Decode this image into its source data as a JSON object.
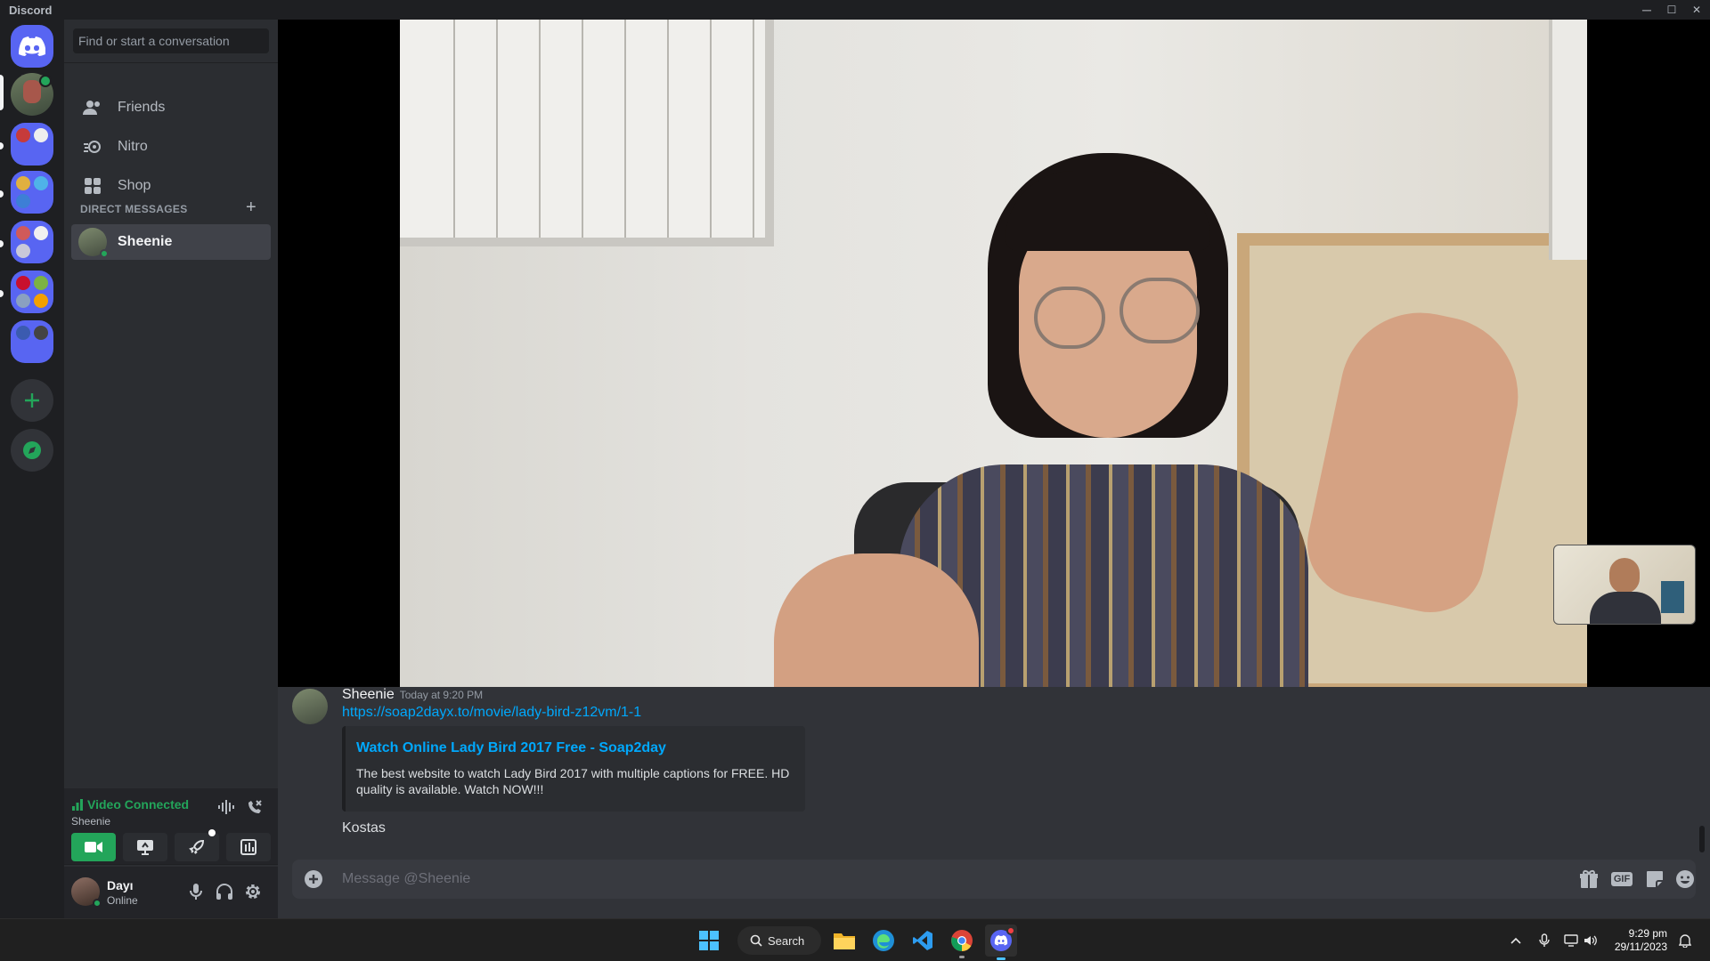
{
  "window": {
    "title": "Discord",
    "minimize": "─",
    "maximize": "☐",
    "close": "✕"
  },
  "search": {
    "placeholder": "Find or start a conversation"
  },
  "nav": {
    "friends": "Friends",
    "nitro": "Nitro",
    "shop": "Shop"
  },
  "direct_messages": {
    "header": "DIRECT MESSAGES",
    "add": "+",
    "items": [
      {
        "name": "Sheenie"
      }
    ]
  },
  "voice": {
    "status": "Video Connected",
    "channel": "Sheenie"
  },
  "user": {
    "name": "Dayı",
    "status": "Online"
  },
  "chat": {
    "author": "Sheenie",
    "timestamp": "Today at 9:20 PM",
    "link": "https://soap2dayx.to/movie/lady-bird-z12vm/1-1",
    "embed_title": "Watch Online Lady Bird 2017 Free - Soap2day",
    "embed_desc": "The best website to watch Lady Bird 2017 with multiple captions for FREE. HD quality is available. Watch NOW!!!",
    "message2": "Kostas"
  },
  "composer": {
    "placeholder": "Message @Sheenie",
    "gif": "GIF"
  },
  "taskbar": {
    "search": "Search",
    "time": "9:29 pm",
    "date": "29/11/2023"
  },
  "colors": {
    "blurple": "#5865f2",
    "green": "#23a55a",
    "link": "#00a8fc",
    "bg": "#313338",
    "sidebar": "#2b2d31",
    "rail": "#1e1f22"
  }
}
